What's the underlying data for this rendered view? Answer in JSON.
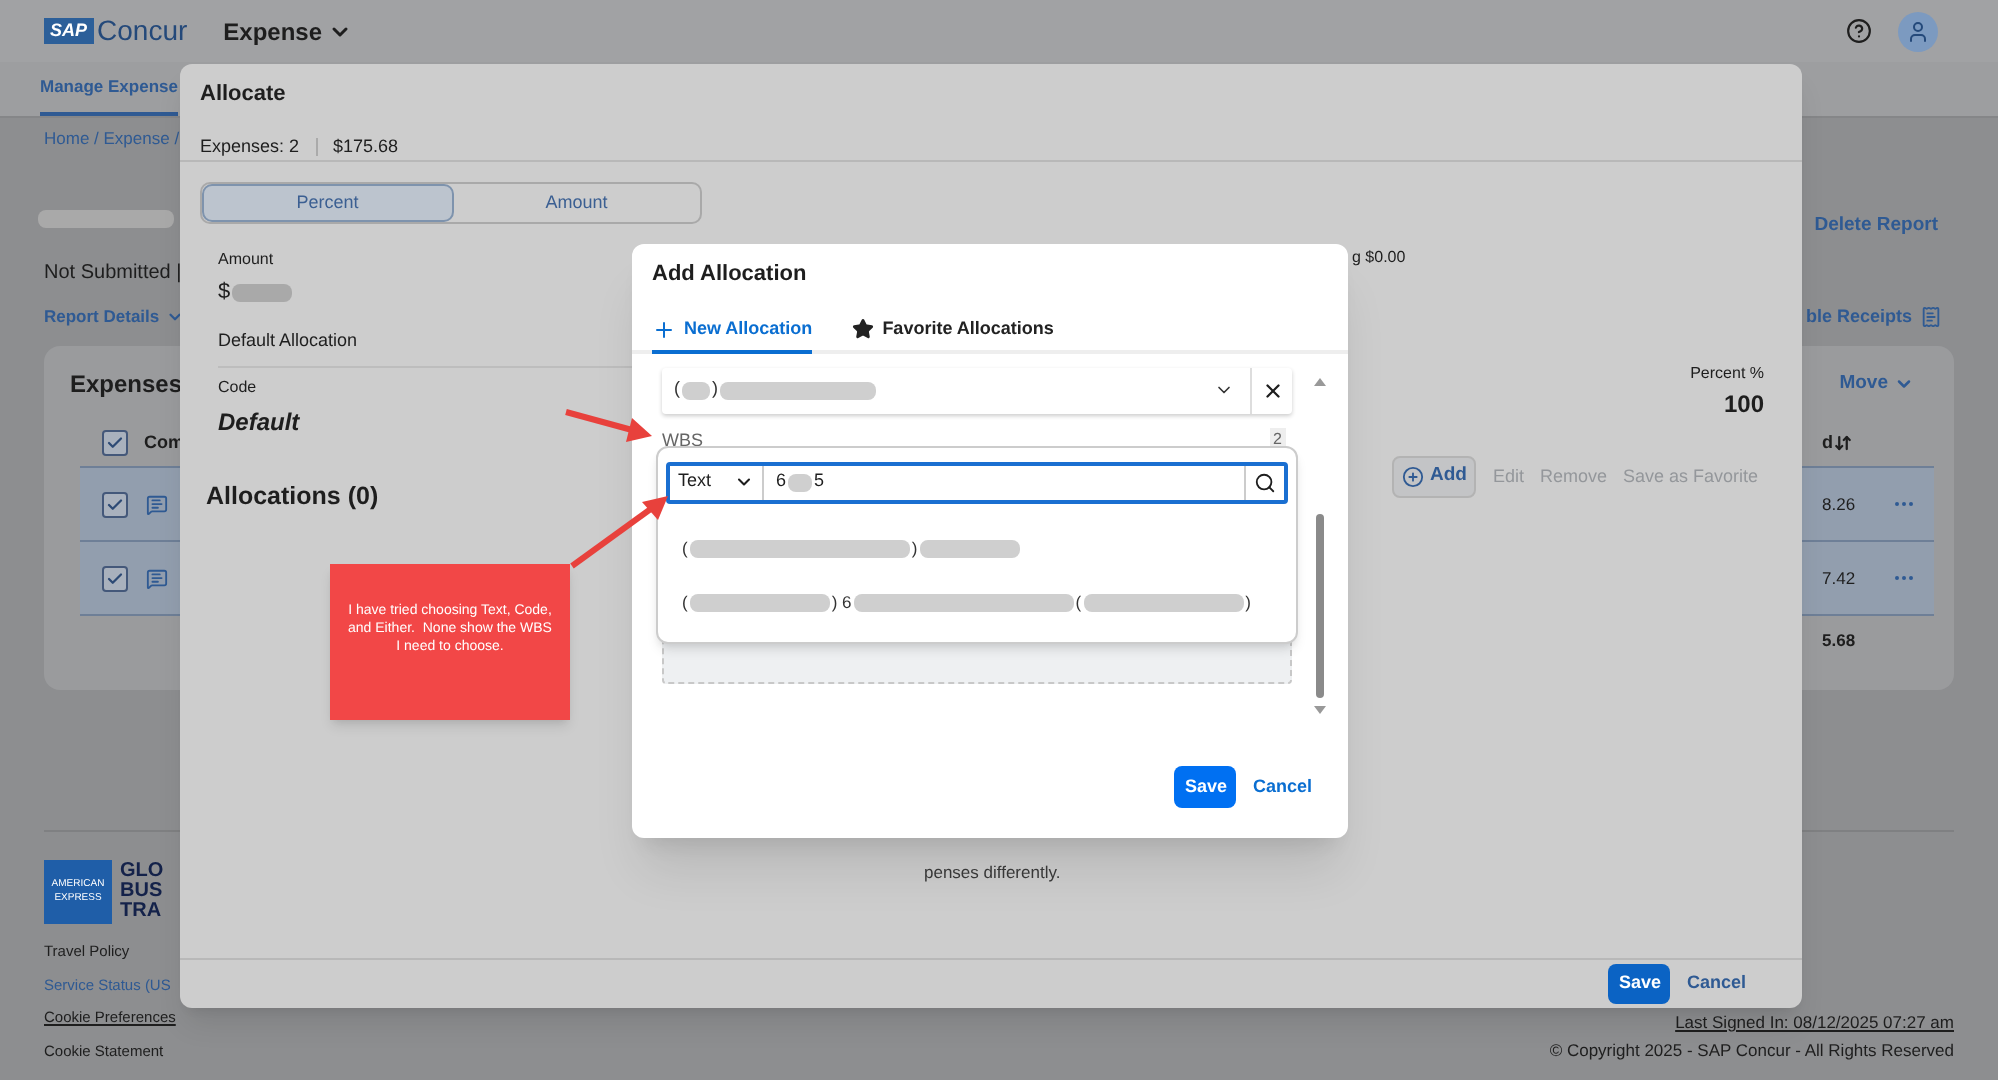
{
  "header": {
    "logo_badge": "SAP",
    "logo_text": "Concur",
    "product_menu": "Expense"
  },
  "nav_tabs": [
    {
      "label": "Manage Expense",
      "selected": true
    }
  ],
  "breadcrumb": "Home / Expense /",
  "report": {
    "title": [
      {
        "kind": "redacted"
      }
    ],
    "status": "Not Submitted |",
    "details_menu": "Report Details",
    "delete_link": "Delete Report",
    "receipts_link": "ble Receipts"
  },
  "expenses_card": {
    "title": "Expenses",
    "move_menu": "Move",
    "header_checked": true,
    "column_2": "Com",
    "column_last": "d",
    "rows": [
      {
        "checked": true,
        "amount": "8.26"
      },
      {
        "checked": true,
        "amount": "7.42"
      }
    ],
    "total": "5.68"
  },
  "footer": {
    "badge_lines": [
      "AMERICAN",
      "EXPRESS"
    ],
    "logo_lines": [
      "GLO",
      "BUS",
      "TRA"
    ],
    "links": [
      {
        "label": "Travel Policy",
        "kind": "plain"
      },
      {
        "label": "Service Status (US",
        "kind": "link"
      },
      {
        "label": "Cookie Preferences",
        "kind": "underlined"
      },
      {
        "label": "Cookie Statement",
        "kind": "plain"
      }
    ],
    "last_signed_in": "Last Signed In: 08/12/2025 07:27 am",
    "copyright": "© Copyright 2025 - SAP Concur - All Rights Reserved"
  },
  "allocate_dialog": {
    "title": "Allocate",
    "expense_count": "Expenses: 2",
    "total": "$175.68",
    "mode_tabs": [
      {
        "label": "Percent",
        "selected": true
      },
      {
        "label": "Amount",
        "selected": false
      }
    ],
    "amount_label": "Amount",
    "amount_value": [
      {
        "kind": "text",
        "text": "$"
      },
      {
        "kind": "redacted"
      }
    ],
    "default_allocation": "Default Allocation",
    "code_label": "Code",
    "code_value": "Default",
    "remaining": "g $0.00",
    "percent_label": "Percent %",
    "percent_value": "100",
    "allocations_heading": "Allocations (0)",
    "actions": [
      {
        "label": "Add",
        "kind": "add",
        "disabled": false
      },
      {
        "label": "Edit",
        "kind": "plain",
        "disabled": true
      },
      {
        "label": "Remove",
        "kind": "plain",
        "disabled": true
      },
      {
        "label": "Save as Favorite",
        "kind": "plain",
        "disabled": true
      }
    ],
    "hint": "penses differently.",
    "buttons": [
      {
        "label": "Save",
        "kind": "primary"
      },
      {
        "label": "Cancel",
        "kind": "secondary"
      }
    ]
  },
  "add_allocation_dialog": {
    "title": "Add Allocation",
    "tabs": [
      {
        "label": "New Allocation",
        "kind": "new",
        "selected": true
      },
      {
        "label": "Favorite Allocations",
        "kind": "favorite",
        "selected": false
      }
    ],
    "select_value": [
      {
        "kind": "text",
        "text": "("
      },
      {
        "kind": "redacted"
      },
      {
        "kind": "text",
        "text": ")"
      },
      {
        "kind": "redacted"
      }
    ],
    "wbs_label": "WBS",
    "wbs_count": "2",
    "search_mode": "Text",
    "search_value": [
      {
        "kind": "text",
        "text": "6"
      },
      {
        "kind": "redacted"
      },
      {
        "kind": "text",
        "text": "5"
      }
    ],
    "results": [
      {
        "segments": [
          {
            "kind": "text",
            "text": "("
          },
          {
            "kind": "redacted"
          },
          {
            "kind": "text",
            "text": ")"
          },
          {
            "kind": "redacted"
          }
        ]
      },
      {
        "segments": [
          {
            "kind": "text",
            "text": "("
          },
          {
            "kind": "redacted"
          },
          {
            "kind": "text",
            "text": ") 6"
          },
          {
            "kind": "redacted"
          },
          {
            "kind": "text",
            "text": "("
          },
          {
            "kind": "redacted"
          },
          {
            "kind": "text",
            "text": ")"
          }
        ]
      }
    ],
    "buttons": [
      {
        "label": "Save",
        "kind": "primary"
      },
      {
        "label": "Cancel",
        "kind": "secondary"
      }
    ]
  },
  "annotation": {
    "text": "I have tried choosing Text, Code, and Either.  None show the WBS I need to choose."
  }
}
